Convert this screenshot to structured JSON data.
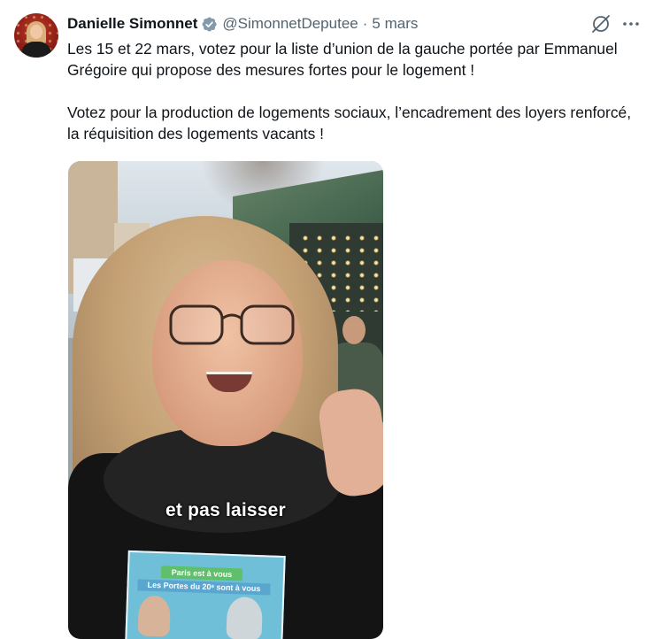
{
  "tweet": {
    "author_name": "Danielle Simonnet",
    "handle": "@SimonnetDeputee",
    "separator": "·",
    "time": "5 mars",
    "paragraphs": [
      "Les 15 et 22 mars, votez pour la liste d’union de la gauche portée par Emmanuel Grégoire qui propose des mesures fortes pour le logement !",
      "Votez pour la production de logements sociaux, l’encadrement des loyers renforcé, la réquisition des logements vacants !"
    ],
    "video_caption": "et pas laisser",
    "flyer_line1": "Paris est à vous",
    "flyer_line2": "Les Portes du 20ᵉ sont à vous"
  },
  "icons": {
    "verified": "verified-badge-icon",
    "grok": "grok-icon",
    "more": "more-options-icon"
  },
  "colors": {
    "text": "#0f1419",
    "secondary": "#536471",
    "verified_badge": "#829aab"
  }
}
